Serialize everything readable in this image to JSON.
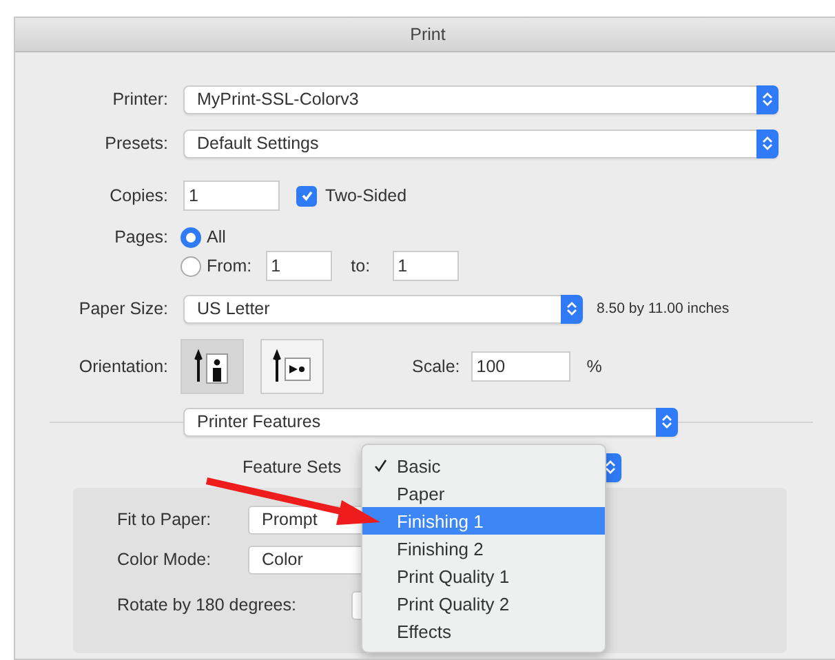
{
  "window": {
    "title": "Print"
  },
  "printer": {
    "label": "Printer:",
    "value": "MyPrint-SSL-Colorv3"
  },
  "presets": {
    "label": "Presets:",
    "value": "Default Settings"
  },
  "copies": {
    "label": "Copies:",
    "value": "1"
  },
  "two_sided": {
    "label": "Two-Sided",
    "checked": true
  },
  "pages": {
    "label": "Pages:",
    "options": [
      {
        "label": "All",
        "selected": true
      },
      {
        "label": "From:",
        "selected": false
      }
    ],
    "from": "1",
    "to_label": "to:",
    "to": "1"
  },
  "paper_size": {
    "label": "Paper Size:",
    "value": "US Letter",
    "dimensions": "8.50 by 11.00 inches"
  },
  "orientation": {
    "label": "Orientation:",
    "options": [
      {
        "kind": "portrait",
        "selected": true
      },
      {
        "kind": "landscape",
        "selected": false
      }
    ]
  },
  "scale": {
    "label": "Scale:",
    "value": "100",
    "unit": "%"
  },
  "section_menu": {
    "value": "Printer Features"
  },
  "feature_sets": {
    "label": "Feature Sets",
    "menu": [
      {
        "label": "Basic",
        "checked": true,
        "selected": false
      },
      {
        "label": "Paper",
        "checked": false,
        "selected": false
      },
      {
        "label": "Finishing 1",
        "checked": false,
        "selected": true
      },
      {
        "label": "Finishing 2",
        "checked": false,
        "selected": false
      },
      {
        "label": "Print Quality 1",
        "checked": false,
        "selected": false
      },
      {
        "label": "Print Quality 2",
        "checked": false,
        "selected": false
      },
      {
        "label": "Effects",
        "checked": false,
        "selected": false
      }
    ]
  },
  "settings": [
    {
      "label": "Fit to Paper:",
      "value": "Prompt"
    },
    {
      "label": "Color Mode:",
      "value": "Color"
    },
    {
      "label": "Rotate by 180 degrees:"
    }
  ]
}
